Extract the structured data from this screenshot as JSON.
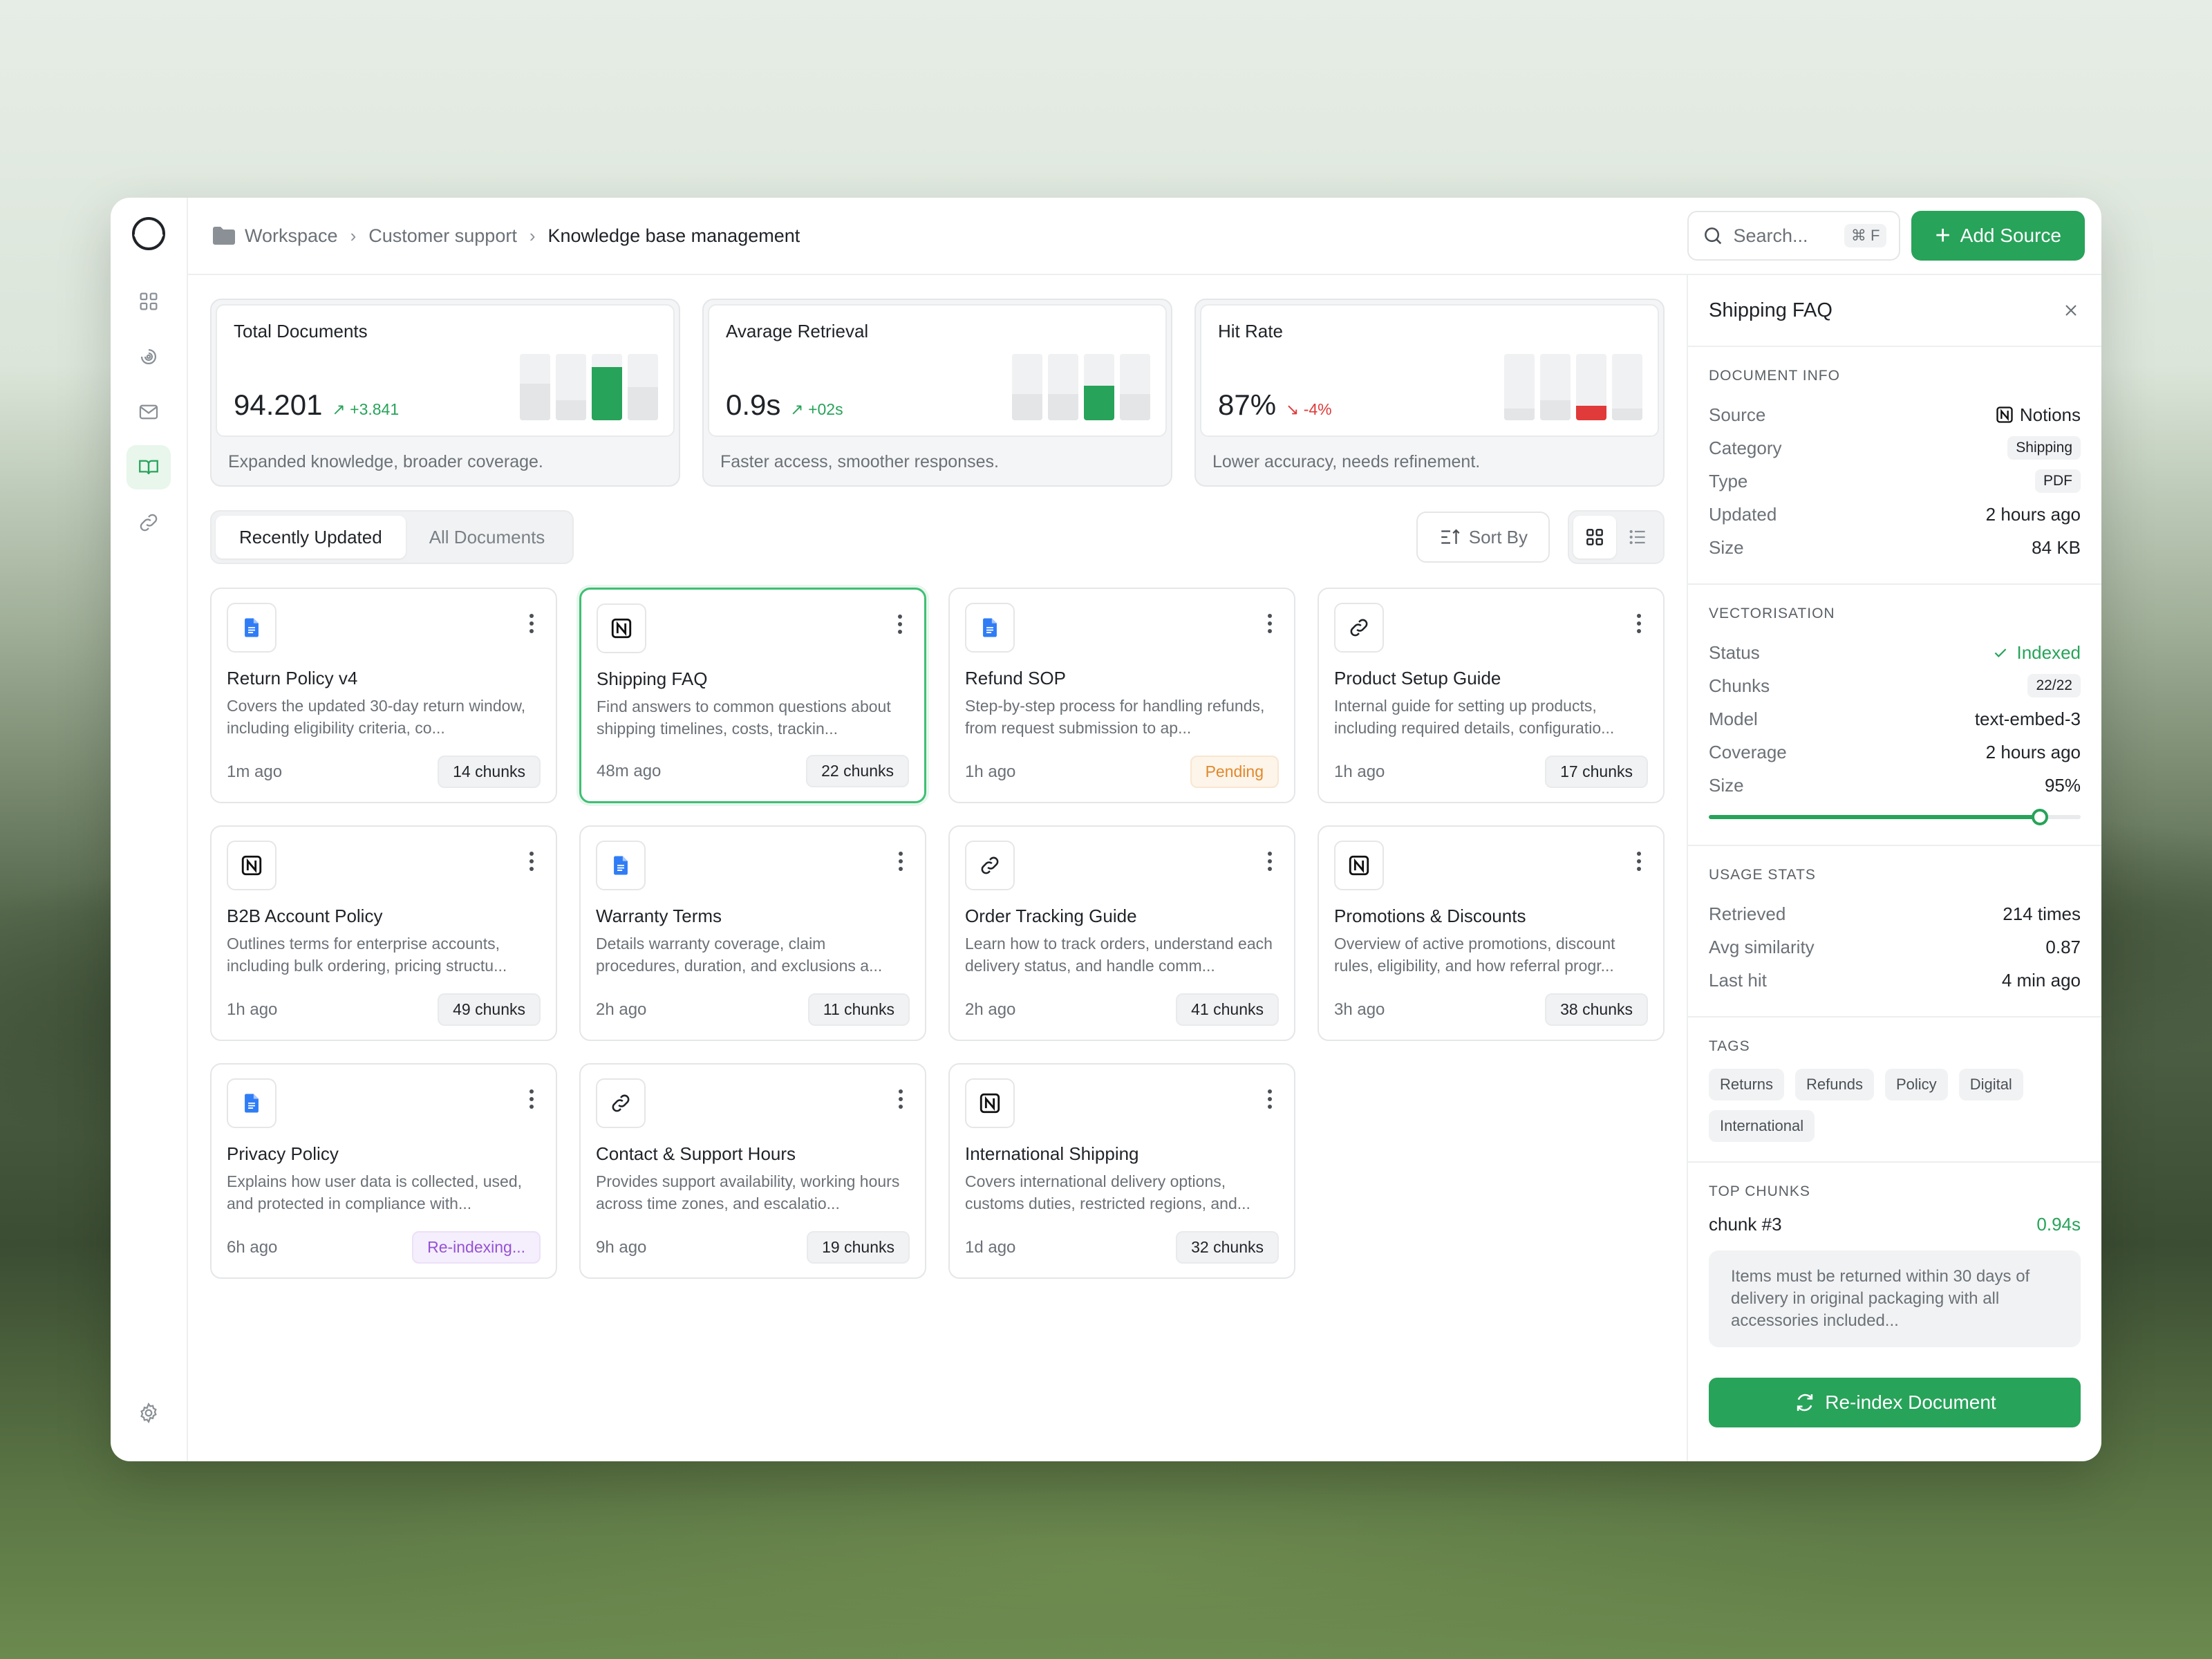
{
  "breadcrumb": {
    "items": [
      "Workspace",
      "Customer support",
      "Knowledge base management"
    ]
  },
  "search": {
    "placeholder": "Search...",
    "shortcut": "⌘ F"
  },
  "header": {
    "add_source_label": "Add Source"
  },
  "stats": [
    {
      "title": "Total Documents",
      "value": "94.201",
      "delta": "+3.841",
      "trend": "up",
      "caption": "Expanded knowledge, broader coverage.",
      "highlight_index": 2,
      "levels": [
        0.55,
        0.3,
        0.8,
        0.5
      ],
      "highlight_color": "#27a35a"
    },
    {
      "title": "Avarage Retrieval",
      "value": "0.9s",
      "delta": "+02s",
      "trend": "up",
      "caption": "Faster access, smoother responses.",
      "highlight_index": 2,
      "levels": [
        0.4,
        0.4,
        0.52,
        0.4
      ],
      "highlight_color": "#27a35a"
    },
    {
      "title": "Hit Rate",
      "value": "87%",
      "delta": "-4%",
      "trend": "down",
      "caption": "Lower accuracy, needs refinement.",
      "highlight_index": 2,
      "levels": [
        0.18,
        0.3,
        0.22,
        0.18
      ],
      "highlight_color": "#e03a3a"
    }
  ],
  "tabs": [
    {
      "label": "Recently Updated",
      "active": true
    },
    {
      "label": "All Documents",
      "active": false
    }
  ],
  "sort": {
    "label": "Sort By"
  },
  "documents": [
    {
      "title": "Return Policy v4",
      "desc": "Covers the updated 30-day return window, including eligibility criteria, co...",
      "time": "1m ago",
      "badge": "14 chunks",
      "badge_type": "default",
      "icon": "gdoc-icon"
    },
    {
      "title": "Shipping FAQ",
      "desc": "Find answers to common questions about shipping timelines, costs, trackin...",
      "time": "48m ago",
      "badge": "22 chunks",
      "badge_type": "default",
      "icon": "notion-icon",
      "selected": true
    },
    {
      "title": "Refund SOP",
      "desc": "Step-by-step process for handling refunds, from request submission to ap...",
      "time": "1h ago",
      "badge": "Pending",
      "badge_type": "pending",
      "icon": "gdoc-icon"
    },
    {
      "title": "Product Setup Guide",
      "desc": "Internal guide for setting up products, including required details, configuratio...",
      "time": "1h ago",
      "badge": "17 chunks",
      "badge_type": "default",
      "icon": "link-icon"
    },
    {
      "title": "B2B Account Policy",
      "desc": "Outlines terms for enterprise accounts, including bulk ordering, pricing structu...",
      "time": "1h ago",
      "badge": "49 chunks",
      "badge_type": "default",
      "icon": "notion-icon"
    },
    {
      "title": "Warranty Terms",
      "desc": "Details warranty coverage, claim procedures, duration, and exclusions a...",
      "time": "2h ago",
      "badge": "11 chunks",
      "badge_type": "default",
      "icon": "gdoc-icon"
    },
    {
      "title": "Order Tracking Guide",
      "desc": "Learn how to track orders, understand each delivery status, and handle comm...",
      "time": "2h ago",
      "badge": "41 chunks",
      "badge_type": "default",
      "icon": "link-icon"
    },
    {
      "title": "Promotions & Discounts",
      "desc": "Overview of active promotions, discount rules, eligibility, and how referral progr...",
      "time": "3h ago",
      "badge": "38 chunks",
      "badge_type": "default",
      "icon": "notion-icon"
    },
    {
      "title": "Privacy Policy",
      "desc": "Explains how user data is collected, used, and protected in compliance with...",
      "time": "6h ago",
      "badge": "Re-indexing...",
      "badge_type": "reindex",
      "icon": "gdoc-icon"
    },
    {
      "title": "Contact & Support Hours",
      "desc": "Provides support availability, working hours across time zones, and escalatio...",
      "time": "9h ago",
      "badge": "19 chunks",
      "badge_type": "default",
      "icon": "link-icon"
    },
    {
      "title": "International Shipping",
      "desc": "Covers international delivery options, customs duties, restricted regions, and...",
      "time": "1d ago",
      "badge": "32 chunks",
      "badge_type": "default",
      "icon": "notion-icon"
    }
  ],
  "panel": {
    "title": "Shipping FAQ",
    "doc_info": {
      "title": "DOCUMENT INFO",
      "source_k": "Source",
      "source_v": "Notions",
      "category_k": "Category",
      "category_v": "Shipping",
      "type_k": "Type",
      "type_v": "PDF",
      "updated_k": "Updated",
      "updated_v": "2 hours ago",
      "size_k": "Size",
      "size_v": "84 KB"
    },
    "vector": {
      "title": "VECTORISATION",
      "status_k": "Status",
      "status_v": "Indexed",
      "chunks_k": "Chunks",
      "chunks_v": "22/22",
      "model_k": "Model",
      "model_v": "text-embed-3",
      "coverage_k": "Coverage",
      "coverage_v": "2 hours ago",
      "size_k": "Size",
      "size_v": "95%",
      "size_level": 0.89
    },
    "usage": {
      "title": "USAGE STATS",
      "retrieved_k": "Retrieved",
      "retrieved_v": "214 times",
      "sim_k": "Avg similarity",
      "sim_v": "0.87",
      "hit_k": "Last hit",
      "hit_v": "4 min ago"
    },
    "tags": {
      "title": "TAGS",
      "items": [
        "Returns",
        "Refunds",
        "Policy",
        "Digital",
        "International"
      ]
    },
    "top_chunks": {
      "title": "TOP CHUNKS",
      "name": "chunk #3",
      "score": "0.94s",
      "text": "Items must be returned within 30 days of delivery in original packaging with all accessories included..."
    },
    "reindex_label": "Re-index Document"
  },
  "colors": {
    "accent": "#27a35a",
    "danger": "#e03a3a",
    "pending": "#e0892a",
    "reindex": "#9552d4"
  }
}
